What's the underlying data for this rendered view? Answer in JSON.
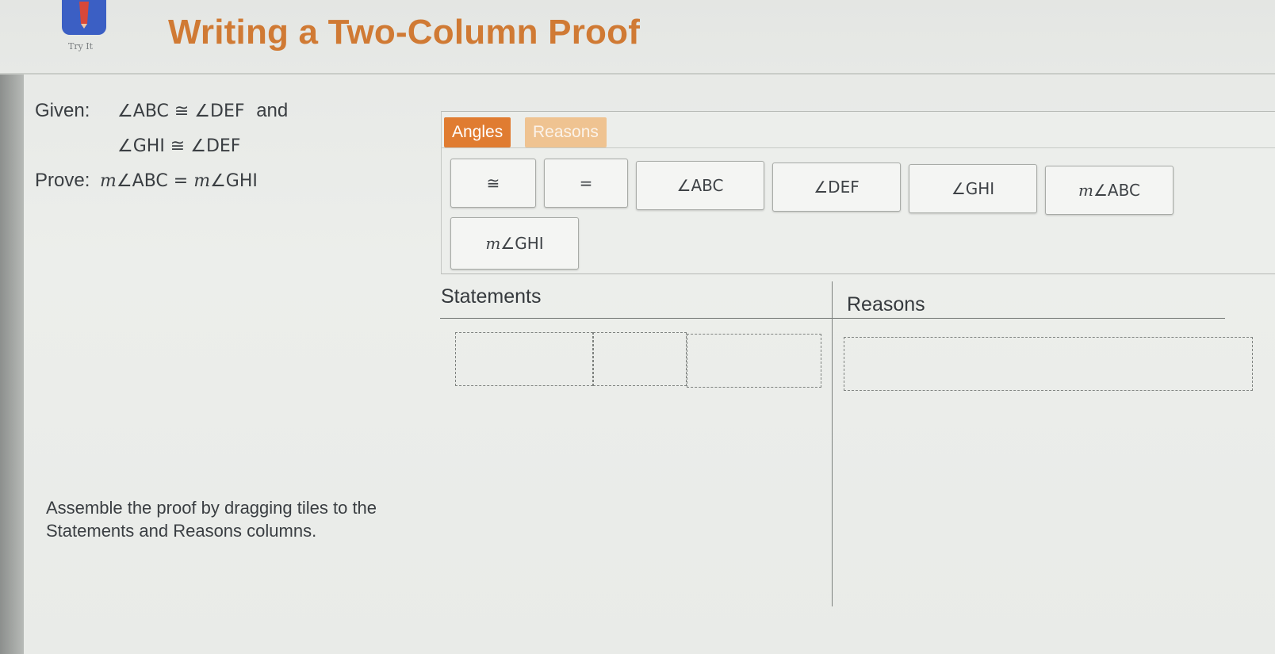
{
  "header": {
    "title": "Writing a Two-Column Proof",
    "try_label": "Try It"
  },
  "given": {
    "label": "Given:",
    "line1": "∠ABC ≅ ∠DEF",
    "line1_suffix": "and",
    "line2": "∠GHI ≅ ∠DEF"
  },
  "prove": {
    "label": "Prove:",
    "m1": "m",
    "expr1": "∠ABC = ",
    "m2": "m",
    "expr2": "∠GHI"
  },
  "tabs": {
    "angles": "Angles",
    "reasons": "Reasons"
  },
  "tiles": [
    {
      "text": "≅"
    },
    {
      "text": "="
    },
    {
      "text": "∠ABC"
    },
    {
      "text": "∠DEF"
    },
    {
      "text": "∠GHI"
    },
    {
      "m": "m",
      "text": "∠ABC"
    },
    {
      "m": "m",
      "text": "∠GHI"
    }
  ],
  "table": {
    "statements_header": "Statements",
    "reasons_header": "Reasons"
  },
  "instructions": "Assemble the proof by dragging tiles to the Statements and Reasons columns.",
  "colors": {
    "title": "#d07a34",
    "tab_active": "#e07c31",
    "tab_inactive": "#efc391",
    "logo": "#3b5fc4"
  }
}
